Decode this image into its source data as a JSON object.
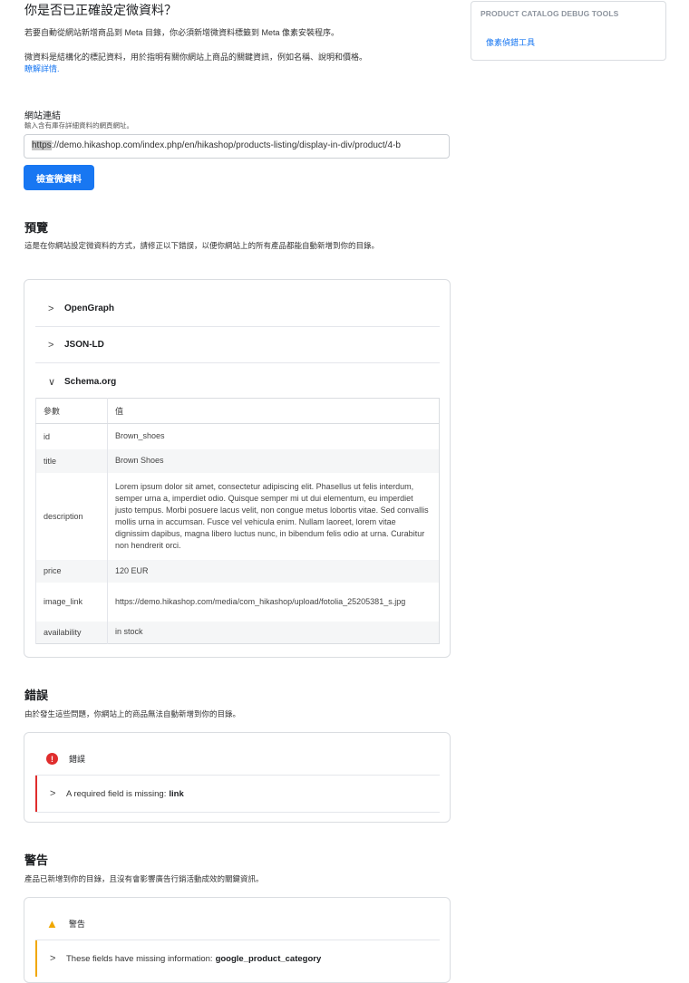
{
  "header": {
    "title": "你是否已正確設定微資料？",
    "intro": "若要自動從網站新增商品到 Meta 目錄，你必須新增微資料標籤到 Meta 像素安裝程序。",
    "description": "微資料是結構化的標記資料，用於指明有關你網站上商品的關鍵資訊，例如名稱、說明和價格。",
    "learn_more": "瞭解詳情."
  },
  "url_form": {
    "label": "網站連結",
    "sublabel": "輸入含有庫存詳細資料的網頁網址。",
    "value_prefix": "https",
    "value_rest": "://demo.hikashop.com/index.php/en/hikashop/products-listing/display-in-div/product/4-b",
    "button": "檢查微資料"
  },
  "preview": {
    "title": "預覽",
    "description": "這是在你網站設定微資料的方式，請修正以下錯誤，以便你網站上的所有產品都能自動新增到你的目錄。",
    "sections": [
      {
        "chevron": ">",
        "label": "OpenGraph"
      },
      {
        "chevron": ">",
        "label": "JSON-LD"
      },
      {
        "chevron": "∨",
        "label": "Schema.org"
      }
    ],
    "table": {
      "headers": [
        "參數",
        "值"
      ],
      "rows": [
        {
          "key": "id",
          "value": "Brown_shoes"
        },
        {
          "key": "title",
          "value": "Brown Shoes"
        },
        {
          "key": "description",
          "value": "Lorem ipsum dolor sit amet, consectetur adipiscing elit. Phasellus ut felis interdum, semper urna a, imperdiet odio. Quisque semper mi ut dui elementum, eu imperdiet justo tempus. Morbi posuere lacus velit, non congue metus lobortis vitae. Sed convallis mollis urna in accumsan. Fusce vel vehicula enim. Nullam laoreet, lorem vitae dignissim dapibus, magna libero luctus nunc, in bibendum felis odio at urna. Curabitur non hendrerit orci."
        },
        {
          "key": "price",
          "value": "120 EUR"
        },
        {
          "key": "image_link",
          "value": "https://demo.hikashop.com/media/com_hikashop/upload/fotolia_25205381_s.jpg"
        },
        {
          "key": "availability",
          "value": "in stock"
        }
      ]
    }
  },
  "errors": {
    "title": "錯誤",
    "description": "由於發生這些問題，你網站上的商品無法自動新增到你的目錄。",
    "card_label": "錯誤",
    "item_text": "A required field is missing:",
    "item_field": "link",
    "icon": "error-circle-icon",
    "color": "#e02d2d"
  },
  "warnings": {
    "title": "警告",
    "description": "產品已新增到你的目錄，且沒有會影響廣告行銷活動成效的關鍵資訊。",
    "card_label": "警告",
    "item_text": "These fields have missing information:",
    "item_field": "google_product_category",
    "icon": "warning-triangle-icon",
    "color": "#f0a700"
  },
  "sidebar": {
    "title": "PRODUCT CATALOG DEBUG TOOLS",
    "link": "像素偵錯工具"
  },
  "colors": {
    "accent": "#1877f2",
    "border": "#dadde1"
  }
}
